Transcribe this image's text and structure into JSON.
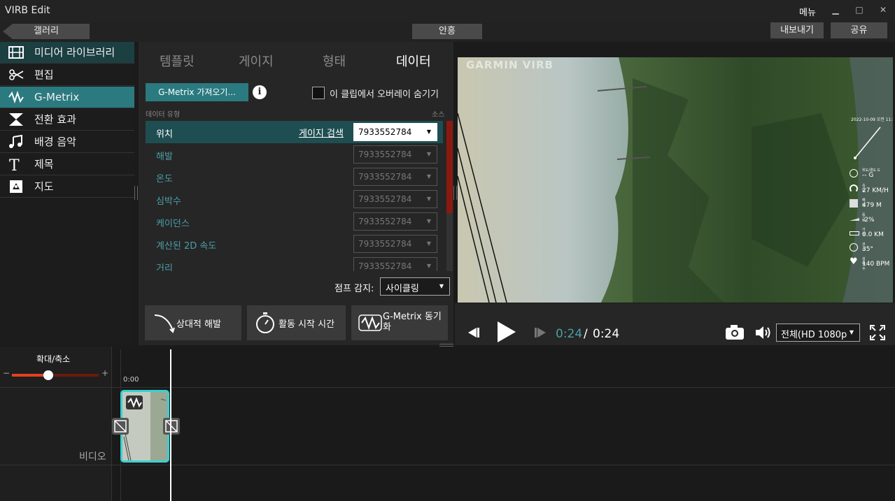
{
  "app": {
    "title": "VIRB Edit",
    "menu": "메뉴",
    "minimize": "▁",
    "maximize": "□",
    "close": "✕"
  },
  "toolbar": {
    "back": "갤러리",
    "help": "안흥",
    "export": "내보내기",
    "share": "공유"
  },
  "sidebar": {
    "items": [
      {
        "label": "미디어 라이브러리",
        "icon": "film-icon"
      },
      {
        "label": "편집",
        "icon": "scissors-icon"
      },
      {
        "label": "G-Metrix",
        "icon": "gmetrix-icon"
      },
      {
        "label": "전환 효과",
        "icon": "transition-icon"
      },
      {
        "label": "배경 음악",
        "icon": "music-icon"
      },
      {
        "label": "제목",
        "icon": "title-icon"
      },
      {
        "label": "지도",
        "icon": "map-icon"
      }
    ]
  },
  "panel": {
    "tabs": [
      "템플릿",
      "게이지",
      "형태",
      "데이터"
    ],
    "import_btn": "G-Metrix 가져오기...",
    "hide_overlay": "이 클립에서 오버레이 숨기기",
    "data_type_label": "데이터 유형",
    "source_label": "소스",
    "gauge_search": "게이지 검색",
    "rows": [
      {
        "name": "위치",
        "source": "7933552784"
      },
      {
        "name": "해발",
        "source": "7933552784"
      },
      {
        "name": "온도",
        "source": "7933552784"
      },
      {
        "name": "심박수",
        "source": "7933552784"
      },
      {
        "name": "케이던스",
        "source": "7933552784"
      },
      {
        "name": "계산된 2D 속도",
        "source": "7933552784"
      },
      {
        "name": "거리",
        "source": "7933552784"
      }
    ],
    "jump_label": "점프 감지:",
    "jump_value": "사이클링",
    "btn_relative": "상대적 해발",
    "btn_start": "활동 시작 시간",
    "btn_sync_1": "G-Metrix 동기",
    "btn_sync_2": "화"
  },
  "preview": {
    "watermark": "GARMIN VIRB",
    "datetime": "2022-10-09 오전 11:2",
    "gauges": [
      {
        "label": "위도/경도 G",
        "value": "-- G"
      },
      {
        "label": "속도",
        "value": "27 KM/H"
      },
      {
        "label": "해발",
        "value": "479 M"
      },
      {
        "label": "등급",
        "value": "-2%"
      },
      {
        "label": "거리",
        "value": "0.0 KM"
      },
      {
        "label": "코스",
        "value": "35°"
      },
      {
        "label": "심박수",
        "value": "140 BPM"
      }
    ]
  },
  "player": {
    "current": "0:24",
    "sep": "/",
    "total": "0:24",
    "quality": "전체(HD 1080p"
  },
  "timeline": {
    "zoom_label": "확대/축소",
    "minus": "−",
    "plus": "+",
    "zoom_level": 0.42,
    "time0": "0:00",
    "track_label": "비디오"
  },
  "colors": {
    "accent": "#2a7a80",
    "selected_row": "#1f4e52",
    "clip_border": "#39d0d0",
    "scrollbar": "#8a1a10"
  }
}
